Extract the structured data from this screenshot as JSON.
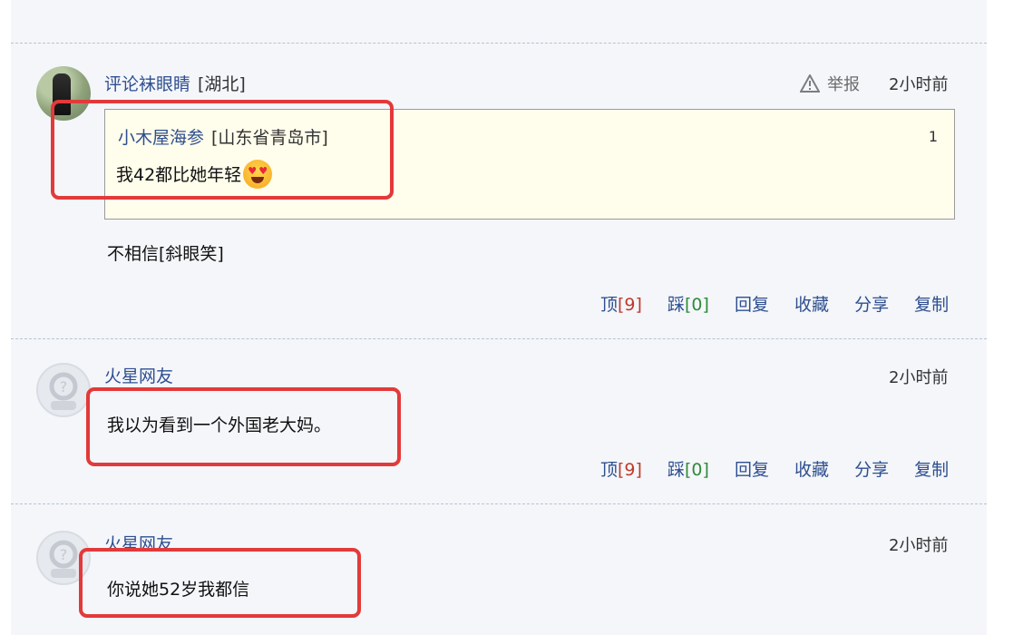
{
  "comments": [
    {
      "user": "评论袜眼睛",
      "region": "[湖北]",
      "report_label": "举报",
      "time": "2小时前",
      "quote": {
        "user": "小木屋海参",
        "region": "[山东省青岛市]",
        "floor": "1",
        "text": "我42都比她年轻"
      },
      "text": "不相信[斜眼笑]",
      "actions": {
        "up_label": "顶",
        "up_count": "[9]",
        "down_label": "踩",
        "down_count": "[0]",
        "reply": "回复",
        "fav": "收藏",
        "share": "分享",
        "copy": "复制"
      }
    },
    {
      "user": "火星网友",
      "time": "2小时前",
      "text": "我以为看到一个外国老大妈。",
      "actions": {
        "up_label": "顶",
        "up_count": "[9]",
        "down_label": "踩",
        "down_count": "[0]",
        "reply": "回复",
        "fav": "收藏",
        "share": "分享",
        "copy": "复制"
      }
    },
    {
      "user": "火星网友",
      "time": "2小时前",
      "text": "你说她52岁我都信"
    }
  ],
  "icons": {
    "report": "warning-triangle-icon",
    "default_avatar": "default-avatar-icon",
    "emoji": "heart-eyes-emoji-icon"
  },
  "colors": {
    "username": "#2f4f8f",
    "highlight": "#e23a3a",
    "quote_bg": "#fffdeb",
    "up_count": "#c0392b",
    "down_count": "#2e8b3a"
  }
}
